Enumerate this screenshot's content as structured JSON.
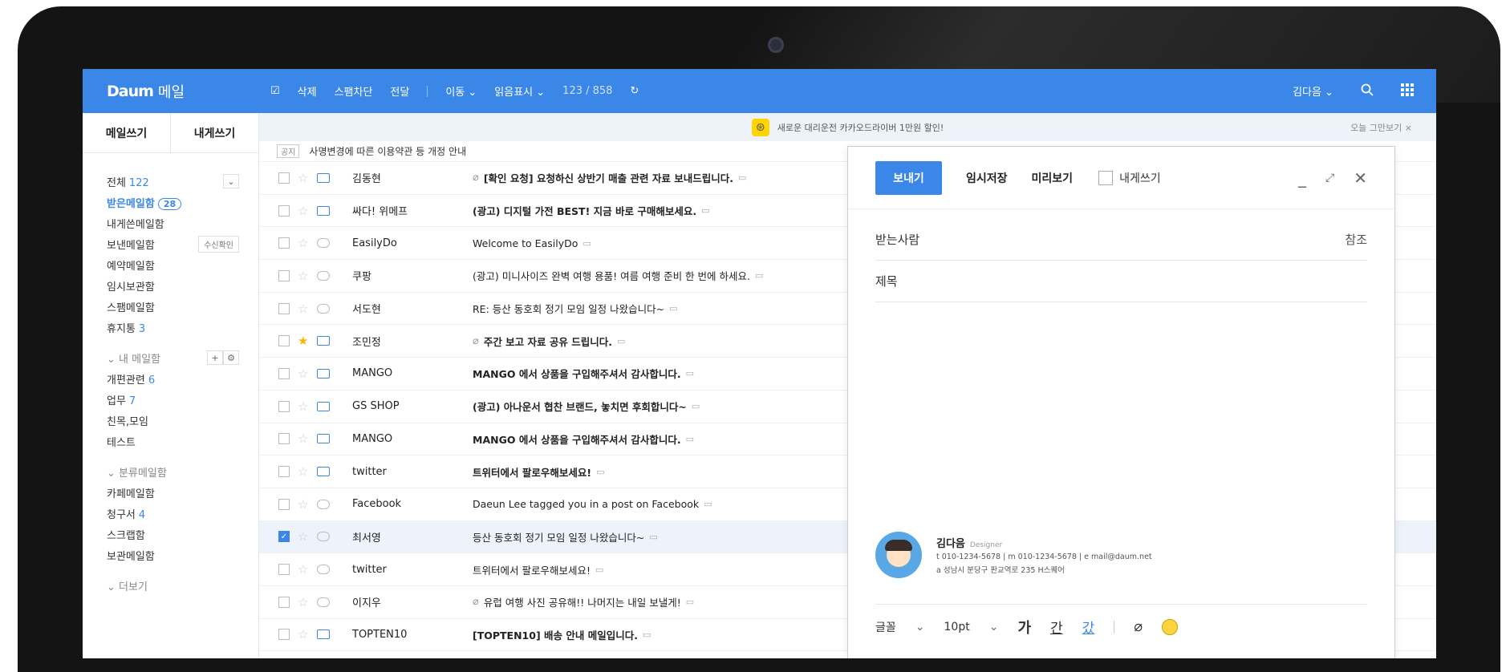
{
  "app": {
    "logo_brand": "Daum",
    "logo_service": "메일"
  },
  "toolbar": {
    "items": [
      "삭제",
      "스팸차단",
      "전달"
    ],
    "move": "이동 ⌄",
    "read_mark": "읽음표시 ⌄",
    "count": "123 / 858",
    "user": "김다음 ⌄"
  },
  "sidebar": {
    "write": "메일쓰기",
    "write_self": "내게쓰기",
    "all_label": "전체",
    "all_count": "122",
    "folders": [
      {
        "label": "받은메일함",
        "count": "28",
        "active": true
      },
      {
        "label": "내게쓴메일함",
        "count": ""
      },
      {
        "label": "보낸메일함",
        "count": "",
        "button": "수신확인"
      },
      {
        "label": "예약메일함",
        "count": ""
      },
      {
        "label": "임시보관함",
        "count": ""
      },
      {
        "label": "스팸메일함",
        "count": ""
      },
      {
        "label": "휴지통",
        "count": "3"
      }
    ],
    "my_group": "⌄ 내 메일함",
    "my_folders": [
      {
        "label": "개편관련",
        "count": "6"
      },
      {
        "label": "업무",
        "count": "7"
      },
      {
        "label": "친목,모임",
        "count": ""
      },
      {
        "label": "테스트",
        "count": ""
      }
    ],
    "class_group": "⌄ 분류메일함",
    "class_folders": [
      {
        "label": "카페메일함",
        "count": ""
      },
      {
        "label": "청구서",
        "count": "4"
      },
      {
        "label": "스크랩함",
        "count": ""
      },
      {
        "label": "보관메일함",
        "count": ""
      }
    ],
    "more": "⌄ 더보기"
  },
  "banner": {
    "text": "새로운 대리운전 카카오드라이버 1만원 할인!",
    "close": "오늘 그만보기 ×"
  },
  "notice": {
    "tag": "공지",
    "text": "사명변경에 따른 이용약관 등 개정 안내"
  },
  "mails": [
    {
      "sender": "김동현",
      "subject": "[확인 요청] 요청하신 상반기 매출 관련 자료 보내드립니다.",
      "bold": true,
      "clip": true,
      "read": false,
      "star": false,
      "selected": false
    },
    {
      "sender": "싸다! 위메프",
      "subject": "(광고) 디지털 가전 BEST! 지금 바로 구매해보세요.",
      "bold": true,
      "clip": false,
      "read": false,
      "star": false,
      "selected": false
    },
    {
      "sender": "EasilyDo",
      "subject": "Welcome to EasilyDo",
      "bold": false,
      "clip": false,
      "read": true,
      "star": false,
      "selected": false
    },
    {
      "sender": "쿠팡",
      "subject": "(광고) 미니사이즈 완벽 여행 용품! 여름 여행 준비 한 번에 하세요.",
      "bold": false,
      "clip": false,
      "read": true,
      "star": false,
      "selected": false
    },
    {
      "sender": "서도현",
      "subject": "RE: 등산 동호회 정기 모임 일정 나왔습니다~",
      "bold": false,
      "clip": false,
      "read": true,
      "star": false,
      "selected": false
    },
    {
      "sender": "조민정",
      "subject": "주간 보고 자료 공유 드립니다.",
      "bold": true,
      "clip": true,
      "read": false,
      "star": true,
      "selected": false
    },
    {
      "sender": "MANGO",
      "subject": "MANGO 에서 상품을 구입해주셔서 감사합니다.",
      "bold": true,
      "clip": false,
      "read": false,
      "star": false,
      "selected": false
    },
    {
      "sender": "GS SHOP",
      "subject": "(광고) 아나운서 협찬 브랜드, 놓치면 후회합니다~",
      "bold": true,
      "clip": false,
      "read": false,
      "star": false,
      "selected": false
    },
    {
      "sender": "MANGO",
      "subject": "MANGO 에서 상품을 구입해주셔서 감사합니다.",
      "bold": true,
      "clip": false,
      "read": false,
      "star": false,
      "selected": false
    },
    {
      "sender": "twitter",
      "subject": "트위터에서 팔로우해보세요!",
      "bold": true,
      "clip": false,
      "read": false,
      "star": false,
      "selected": false
    },
    {
      "sender": "Facebook",
      "subject": "Daeun Lee tagged you in a post on Facebook",
      "bold": false,
      "clip": false,
      "read": true,
      "star": false,
      "selected": false
    },
    {
      "sender": "최서영",
      "subject": "등산 동호회 정기 모임 일정 나왔습니다~",
      "bold": false,
      "clip": false,
      "read": true,
      "star": false,
      "selected": true
    },
    {
      "sender": "twitter",
      "subject": "트위터에서 팔로우해보세요!",
      "bold": false,
      "clip": false,
      "read": true,
      "star": false,
      "selected": false
    },
    {
      "sender": "이지우",
      "subject": "유럽 여행 사진 공유해!! 나머지는 내일 보낼게!",
      "bold": false,
      "clip": true,
      "read": true,
      "star": false,
      "selected": false
    },
    {
      "sender": "TOPTEN10",
      "subject": "[TOPTEN10] 배송 안내 메일입니다.",
      "bold": true,
      "clip": false,
      "read": false,
      "star": false,
      "selected": false
    }
  ],
  "compose": {
    "send": "보내기",
    "save_draft": "임시저장",
    "preview": "미리보기",
    "to_self": "내게쓰기",
    "to_label": "받는사람",
    "cc_label": "참조",
    "subject_label": "제목",
    "signature": {
      "name": "김다음",
      "role": "Designer",
      "line1": "t 010-1234-5678 | m 010-1234-5678 | e mail@daum.net",
      "line2": "a 성남시 분당구 판교역로 235 H스퀘어"
    },
    "font_label": "글꼴",
    "font_size": "10pt",
    "bold_glyph": "가",
    "underline_glyph": "간",
    "color_glyph": "갔"
  },
  "colors": {
    "accent": "#3b87e8",
    "device": "#141414",
    "star": "#f5b800"
  }
}
